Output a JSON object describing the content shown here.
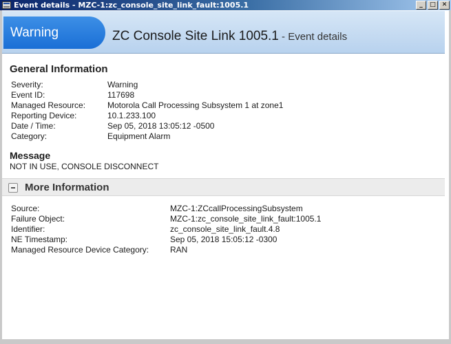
{
  "window": {
    "title": "Event details - MZC-1:zc_console_site_link_fault:1005.1",
    "buttons": {
      "minimize": "_",
      "maximize": "□",
      "close": "✕"
    }
  },
  "header": {
    "severity": "Warning",
    "title": "ZC Console Site Link 1005.1",
    "subtitle": " - Event details",
    "colors": {
      "pill": "#1a6fd6",
      "banner": "#b8d2ee"
    }
  },
  "general": {
    "title": "General Information",
    "rows": [
      {
        "label": "Severity:",
        "value": "Warning"
      },
      {
        "label": "Event ID:",
        "value": "117698"
      },
      {
        "label": "Managed Resource:",
        "value": "Motorola Call Processing Subsystem 1 at zone1"
      },
      {
        "label": "Reporting Device:",
        "value": "10.1.233.100"
      },
      {
        "label": "Date / Time:",
        "value": "Sep 05, 2018 13:05:12 -0500"
      },
      {
        "label": "Category:",
        "value": "Equipment Alarm"
      }
    ]
  },
  "message": {
    "title": "Message",
    "text": "NOT IN USE, CONSOLE DISCONNECT"
  },
  "more": {
    "title": "More Information",
    "rows": [
      {
        "label": "Source:",
        "value": "MZC-1:ZCcallProcessingSubsystem"
      },
      {
        "label": "Failure Object:",
        "value": "MZC-1:zc_console_site_link_fault:1005.1"
      },
      {
        "label": "Identifier:",
        "value": "zc_console_site_link_fault.4.8"
      },
      {
        "label": "NE Timestamp:",
        "value": "Sep 05, 2018 15:05:12 -0300"
      },
      {
        "label": "Managed Resource Device Category:",
        "value": "RAN"
      }
    ]
  }
}
